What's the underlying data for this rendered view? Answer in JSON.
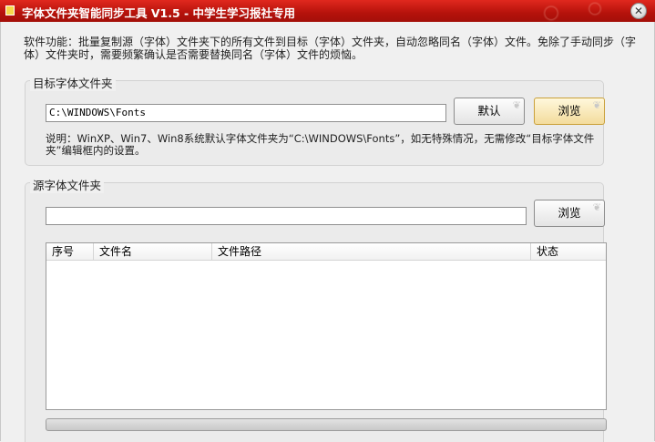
{
  "window": {
    "title": "字体文件夹智能同步工具 V1.5 - 中学生学习报社专用",
    "close_glyph": "✕"
  },
  "description": "软件功能：批量复制源（字体）文件夹下的所有文件到目标（字体）文件夹，自动忽略同名（字体）文件。免除了手动同步（字体）文件夹时，需要频繁确认是否需要替换同名（字体）文件的烦恼。",
  "target_group": {
    "title": "目标字体文件夹",
    "path_value": "C:\\WINDOWS\\Fonts",
    "default_label": "默认",
    "browse_label": "浏览",
    "note": "说明：WinXP、Win7、Win8系统默认字体文件夹为“C:\\WINDOWS\\Fonts”，如无特殊情况，无需修改“目标字体文件夹”编辑框内的设置。"
  },
  "source_group": {
    "title": "源字体文件夹",
    "path_value": "",
    "browse_label": "浏览",
    "columns": [
      "序号",
      "文件名",
      "文件路径",
      "状态"
    ]
  },
  "progress": {
    "value": 0
  }
}
